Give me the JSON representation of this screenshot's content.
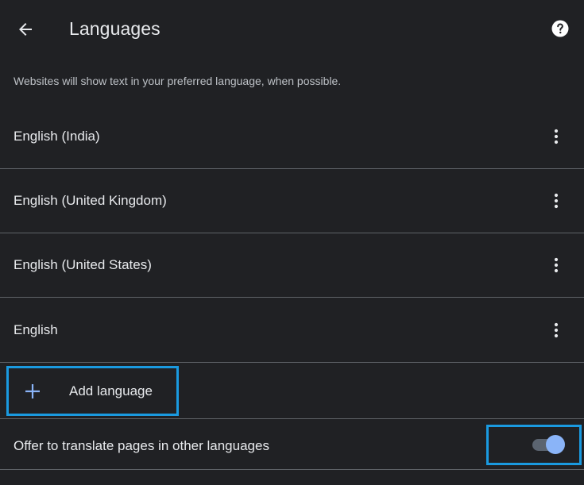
{
  "header": {
    "title": "Languages",
    "back_icon": "arrow-left-icon",
    "help_icon": "help-circle-icon"
  },
  "description": "Websites will show text in your preferred language, when possible.",
  "languages": [
    {
      "label": "English (India)",
      "menu_icon": "more-vert-icon"
    },
    {
      "label": "English (United Kingdom)",
      "menu_icon": "more-vert-icon"
    },
    {
      "label": "English (United States)",
      "menu_icon": "more-vert-icon"
    },
    {
      "label": "English",
      "menu_icon": "more-vert-icon"
    }
  ],
  "add_language": {
    "label": "Add language",
    "icon": "plus-icon"
  },
  "translate": {
    "label": "Offer to translate pages in other languages",
    "enabled": true
  },
  "colors": {
    "background": "#202124",
    "text": "#e8eaed",
    "divider": "#5f6368",
    "accent": "#8ab4f8",
    "highlight": "#1a9ae0"
  }
}
